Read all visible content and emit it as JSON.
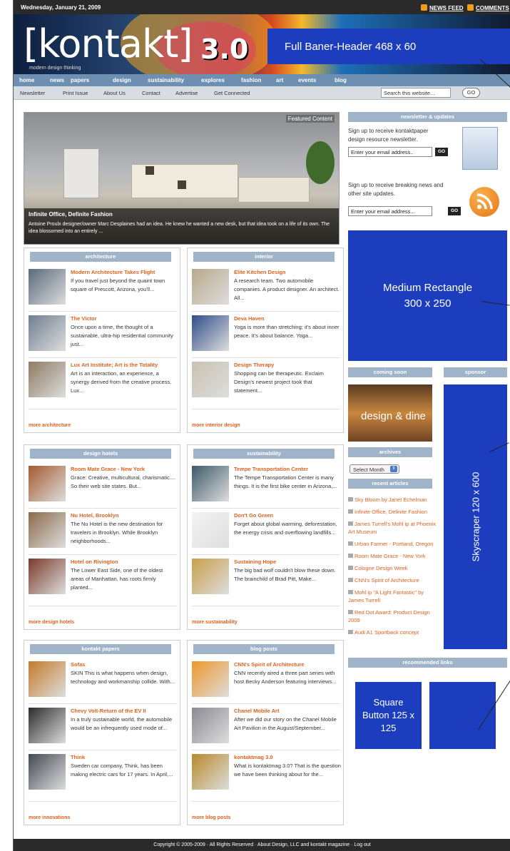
{
  "topbar": {
    "date": "Wednesday, January 21, 2009",
    "news_feed": "NEWS FEED",
    "comments": "COMMENTS"
  },
  "header": {
    "logo": "[kontakt]",
    "tagline": "modern design thinking",
    "version": "3.0",
    "ad_label": "Full Baner-Header 468 x 60"
  },
  "nav": {
    "primary": [
      "home",
      "news",
      "papers",
      "design",
      "sustainability",
      "explores",
      "fashion",
      "art",
      "events",
      "blog"
    ],
    "secondary": [
      "Newsletter",
      "Print Issue",
      "About Us",
      "Contact",
      "Advertise",
      "Get Connected"
    ],
    "search_placeholder": "Search this website...",
    "search_go": "GO"
  },
  "featured": {
    "label": "Featured Content",
    "title": "Infinite Office, Definite Fashion",
    "desc": "Antoine Proulx designer/owner Marc Desplaines had an idea. He knew he wanted a new desk, but that idea took on a life of its own. The idea blossomed into an entirely ..."
  },
  "sections": [
    {
      "title": "architecture",
      "more": "more architecture",
      "articles": [
        {
          "title": "Modern Architecture Takes Flight",
          "desc": "If you travel just beyond the quaint town square of Prescott, Arizona, you'll..."
        },
        {
          "title": "The Victor",
          "desc": "Once upon a time, the thought of a sustainable, ultra-hip residential community  just..."
        },
        {
          "title": "Lux Art Institute; Art is the Totality",
          "desc": "Art is an interaction, an experience, a synergy derived from the creative process. Lux..."
        }
      ]
    },
    {
      "title": "interior",
      "more": "more interior design",
      "articles": [
        {
          "title": "Elite Kitchen Design",
          "desc": "A research team. Two automobile companies. A product designer. An architect. All..."
        },
        {
          "title": "Deva Haven",
          "desc": "Yoga is more than stretching; it's about inner peace. It's about balance. Yoga..."
        },
        {
          "title": "Design Therapy",
          "desc": "Shopping can be therapeutic. Exclaim Design's newest project took that statement..."
        }
      ]
    },
    {
      "title": "design hotels",
      "more": "more design hotels",
      "articles": [
        {
          "title": "Room Mate Grace - New York",
          "desc": "Grace: Creative, multicultural, charismatic.... So their web site states. But..."
        },
        {
          "title": "Nu Hotel, Brooklyn",
          "desc": "The Nu Hotel is the new destination for travelers in Brooklyn. While Brooklyn neighborhoods..."
        },
        {
          "title": "Hotel on Rivington",
          "desc": "The Lower East Side, one of the oldest areas of Manhattan, has roots firmly planted..."
        }
      ]
    },
    {
      "title": "sustainability",
      "more": "more sustainability",
      "articles": [
        {
          "title": "Tempe Transportation Center",
          "desc": "The Tempe Transportation Center is many things. It is the first bike center in Arizona,..."
        },
        {
          "title": "Don't Go Green",
          "desc": "Forget about global warming, deforestation, the energy crisis and overflowing landfills..."
        },
        {
          "title": "Sustaining Hope",
          "desc": "The big bad wolf couldn't blow these down. The brainchild of Brad Pitt, Make..."
        }
      ]
    },
    {
      "title": "kontakt papers",
      "more": "more innovations",
      "articles": [
        {
          "title": "Sofas",
          "desc": "SKIN This is what happens when design, technology and workmanship collide. With..."
        },
        {
          "title": "Chevy Volt-Return of the EV II",
          "desc": "In a truly sustainable world, the automobile would be an infrequently used mode of..."
        },
        {
          "title": "Think",
          "desc": "Sweden car company, Think, has been making electric cars for 17 years. In April,..."
        }
      ]
    },
    {
      "title": "blog posts",
      "more": "more blog posts",
      "articles": [
        {
          "title": "CNN's Spirit of Architecture",
          "desc": "CNN recently aired a three part series with host Becky Anderson featuring interviews..."
        },
        {
          "title": "Chanel Mobile Art",
          "desc": "After we did our story on the Chanel Mobile Art Pavilion in the August/September..."
        },
        {
          "title": "kontaktmag 3.0",
          "desc": "What is kontaktmag 3.0? That is the question we have been thinking about for the..."
        }
      ]
    }
  ],
  "sidebar": {
    "newsletter_title": "newsletter & updates",
    "newsletter_text": "Sign up to receive kontaktpaper design resource newsletter.",
    "email_placeholder": "Enter your email address..",
    "go": "GO",
    "news_text": "Sign up to receive breaking news and other site updates.",
    "email_placeholder2": "Enter your email address...",
    "medium_rect": "Medium Rectangle\n300 x 250",
    "coming_soon": "coming soon",
    "coming_soon_img": "design & dine",
    "sponsor": "sponsor",
    "archives": "archives",
    "archives_select": "Select Month",
    "recent_title": "recent articles",
    "recent": [
      "Sky Bloom by Janet Echelman",
      "Infinite Office, Definite Fashion",
      "James Turrell's Mohl ip at Phoenix Art Museum",
      "Urban Farmer - Portland, Oregon",
      "Room Mate Grace - New York",
      "Cologne Design Week",
      "CNN's Spirit of Architecture",
      "Mohl ip \"A Light Fantastic\" by James Turrell",
      "Red Dot Award: Product Design 2009",
      "Audi A1 Sportback concept"
    ],
    "skyscraper": "Skyscraper 120 x 600",
    "recommended": "recommended links",
    "square": "Square Button 125 x 125"
  },
  "footer": "Copyright © 2005-2009 · All Rights Reserved · About Design, LLC and kontakt magazine · Log out",
  "colors": {
    "accent": "#e0621e",
    "nav": "#6d8fb2",
    "ad": "#1c3dbd",
    "box_head": "#9fb4c9"
  }
}
